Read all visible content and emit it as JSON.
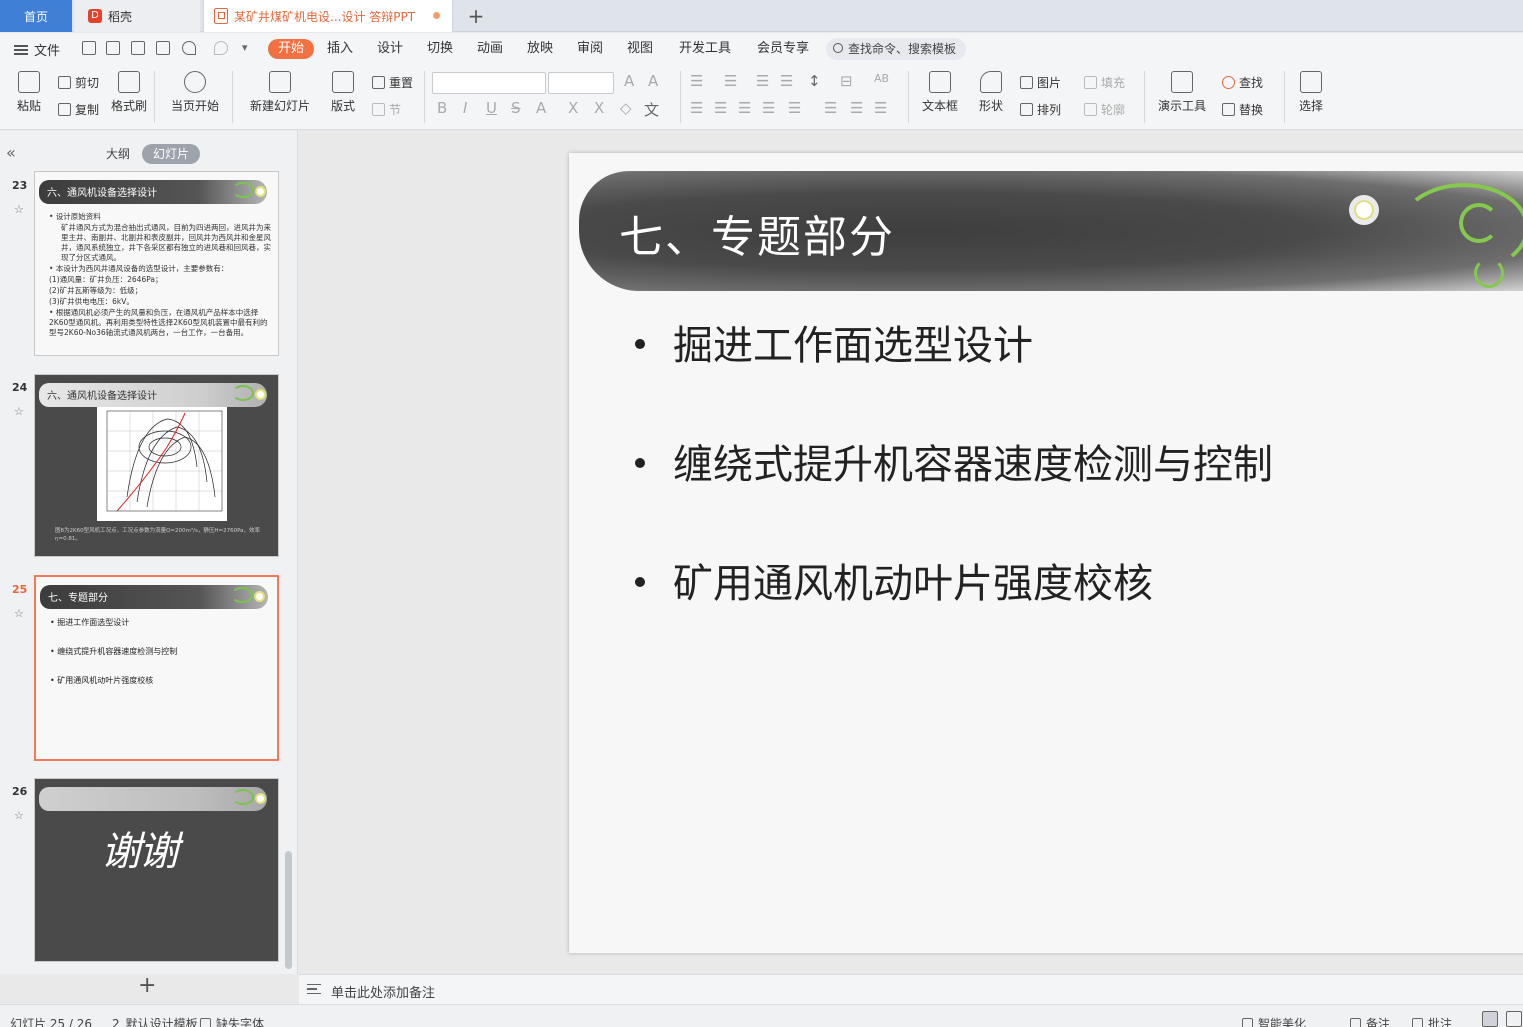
{
  "tabs": {
    "home": "首页",
    "daoke": "稻壳",
    "doc": "某矿井煤矿机电设...设计 答辩PPT",
    "add": "+"
  },
  "menu": {
    "file": "文件",
    "items": [
      "开始",
      "插入",
      "设计",
      "切换",
      "动画",
      "放映",
      "审阅",
      "视图",
      "开发工具",
      "会员专享"
    ],
    "search_placeholder": "查找命令、搜索模板"
  },
  "ribbon": {
    "paste": "粘贴",
    "cut": "剪切",
    "copy": "复制",
    "format_painter": "格式刷",
    "start_current": "当页开始",
    "new_slide": "新建幻灯片",
    "layout": "版式",
    "reset": "重置",
    "section": "节",
    "textbox": "文本框",
    "shape": "形状",
    "picture": "图片",
    "arrange": "排列",
    "fill": "填充",
    "outline": "轮廓",
    "presenter_tools": "演示工具",
    "find": "查找",
    "replace": "替换",
    "select": "选择"
  },
  "left_panel": {
    "tab_outline": "大纲",
    "tab_slides": "幻灯片",
    "add": "+",
    "slides": [
      {
        "number": "23",
        "title": "六、通风机设备选择设计",
        "lines": [
          {
            "type": "bullet",
            "text": "设计原始资料"
          },
          {
            "type": "indent",
            "text": "矿井通风方式为混合抽出式通风，目前为四进两回，进风井为来里主井、南副井、北副井和表皮副井，回风井为西风井和金星风井，通风系统独立，井下各采区都有独立的进风巷和回风巷，实现了分区式通风。"
          },
          {
            "type": "bullet",
            "text": "本设计为西风井通风设备的选型设计，主要参数有："
          },
          {
            "type": "plain",
            "text": "(1)通风量：矿井负压：2646Pa；"
          },
          {
            "type": "plain",
            "text": "(2)矿井瓦斯等级为：低级；"
          },
          {
            "type": "plain",
            "text": "(3)矿井供电电压：6kV。"
          },
          {
            "type": "bullet",
            "text": "根据通风机必须产生的风量和负压，在通风机产品样本中选择2K60型通风机。再利用类型特性选择2K60型风机装置中最有利的型号2K60-No36轴流式通风机两台，一台工作，一台备用。"
          }
        ]
      },
      {
        "number": "24",
        "title": "六、通风机设备选择设计",
        "caption": "图8为2K60型风机工况点，工况点参数为流量Q=200m³/s，静压H=2760Pa，效率η=0.81。"
      },
      {
        "number": "25",
        "title": "七、专题部分",
        "bullets": [
          "掘进工作面选型设计",
          "缠绕式提升机容器速度检测与控制",
          "矿用通风机动叶片强度校核"
        ]
      },
      {
        "number": "26",
        "title": "",
        "text": "谢谢"
      }
    ]
  },
  "slide": {
    "title": "七、专题部分",
    "bullets": [
      "掘进工作面选型设计",
      "缠绕式提升机容器速度检测与控制",
      "矿用通风机动叶片强度校核"
    ]
  },
  "notes": {
    "placeholder": "单击此处添加备注"
  },
  "status": {
    "slide_counter": "幻灯片 25 / 26",
    "theme": "2_默认设计模板",
    "missing_font": "缺失字体",
    "smart_beautify": "智能美化",
    "notes": "备注",
    "comments": "批注"
  },
  "colors": {
    "accent": "#f37141",
    "home_tab": "#3f7fd6",
    "selection": "#f07a5a"
  }
}
